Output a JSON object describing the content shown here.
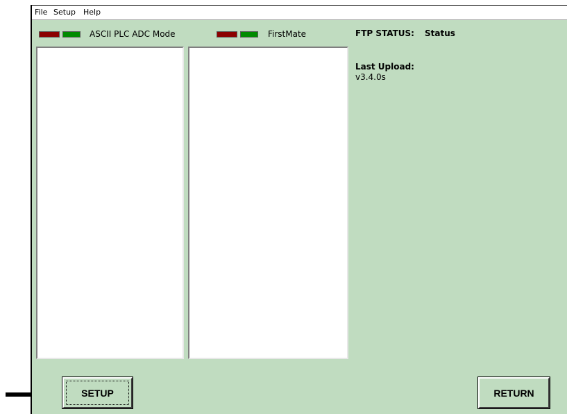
{
  "menu": {
    "file": "File",
    "setup": "Setup",
    "help": "Help"
  },
  "left_panel": {
    "label": "ASCII PLC ADC Mode",
    "indicator_colors": [
      "#8b0000",
      "#008a00"
    ]
  },
  "right_panel": {
    "label": "FirstMate",
    "indicator_colors": [
      "#8b0000",
      "#008a00"
    ]
  },
  "status": {
    "ftp_label": "FTP STATUS:",
    "ftp_value": "Status",
    "last_upload_label": "Last Upload:",
    "last_upload_value": "v3.4.0s"
  },
  "buttons": {
    "setup": "SETUP",
    "return": "RETURN"
  },
  "colors": {
    "window_background": "#c0dcc0",
    "menubar_background": "#ffffff"
  },
  "annotation": {
    "arrow_icon": "right-arrow-icon"
  }
}
